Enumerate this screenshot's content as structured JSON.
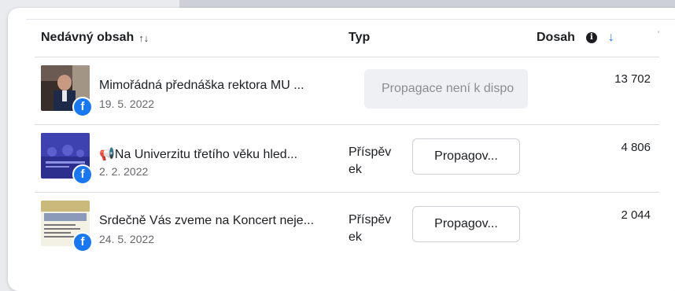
{
  "header": {
    "content_label": "Nedávný obsah",
    "content_sort_icon": "sort-up-down-icon",
    "type_label": "Typ",
    "reach_label": "Dosah",
    "reach_info_icon": "info-icon",
    "reach_sort_icon": "arrow-down-icon"
  },
  "rows": [
    {
      "title": "Mimořádná přednáška rektora MU ...",
      "date": "19. 5. 2022",
      "platform_icon": "facebook-icon",
      "type_label": "",
      "promote_label": "Propagace není k dispo",
      "promote_enabled": false,
      "reach": "13 702"
    },
    {
      "title": "📢Na Univerzitu třetího věku hled...",
      "date": "2. 2. 2022",
      "platform_icon": "facebook-icon",
      "type_label": "Příspěvek",
      "type_line1": "Příspěv",
      "type_line2": "ek",
      "promote_label": "Propagov...",
      "promote_enabled": true,
      "reach": "4 806"
    },
    {
      "title": "Srdečně Vás zveme na Koncert neje...",
      "date": "24. 5. 2022",
      "platform_icon": "facebook-icon",
      "type_label": "Příspěvek",
      "type_line1": "Příspěv",
      "type_line2": "ek",
      "promote_label": "Propagov...",
      "promote_enabled": true,
      "reach": "2 044"
    }
  ],
  "colors": {
    "facebook_blue": "#1877f2",
    "sort_active": "#1877f2",
    "disabled_bg": "#eef0f3"
  }
}
